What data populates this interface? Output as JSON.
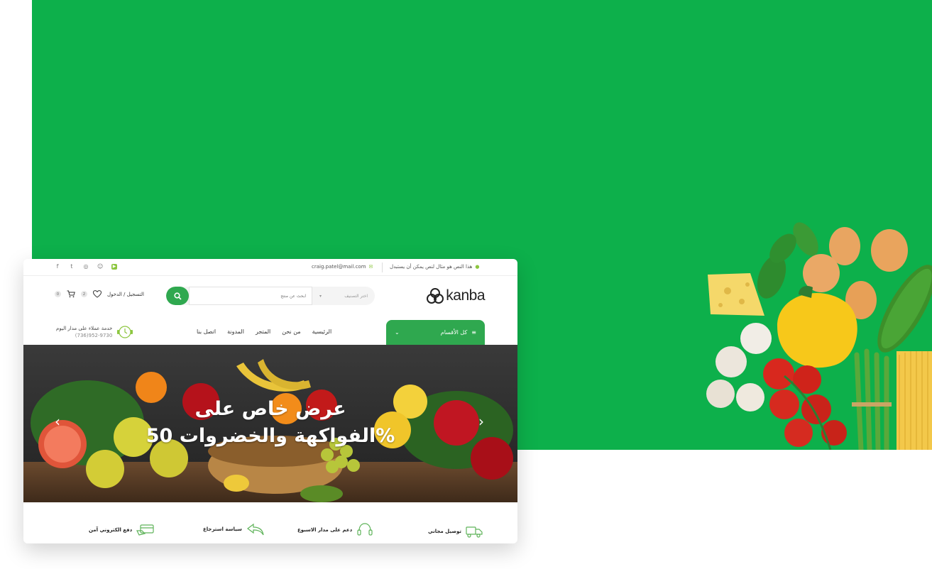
{
  "brand": {
    "name": "kanba",
    "accent": "#0db04b",
    "button_green": "#2fa84f",
    "lime": "#8cc63f"
  },
  "topbar": {
    "location_text": "هذا النص هو مثال لنص يمكن أن يستبدل",
    "email": "craig.patel@mail.com",
    "socials": [
      "youtube-icon",
      "snapchat-icon",
      "instagram-icon",
      "twitter-icon",
      "facebook-icon"
    ]
  },
  "header": {
    "search_category": "اختر التصنيف",
    "search_placeholder": "ابحث عن منتج",
    "account_label": "التسجيل / الدخول",
    "wishlist_count": "2",
    "cart_count": "0"
  },
  "nav": {
    "categories_label": "كل الأقسام",
    "items": [
      "الرئيسية",
      "من نحن",
      "المتجر",
      "المدونة",
      "اتصل بنا"
    ],
    "support_title": "خدمة عملاء على مدار اليوم",
    "support_phone": "(736)952-9730"
  },
  "hero": {
    "line1": "عرض خاص على",
    "line2": "الفواكهة والخضروات 50%"
  },
  "features": [
    {
      "label": "توصيل مجاني",
      "icon": "truck-icon"
    },
    {
      "label": "دعم على مدار الاسبوع",
      "icon": "headset-icon"
    },
    {
      "label": "سياسة استرجاع",
      "icon": "return-arrow-icon"
    },
    {
      "label": "دفع الكتروني آمن",
      "icon": "card-payment-icon"
    }
  ]
}
